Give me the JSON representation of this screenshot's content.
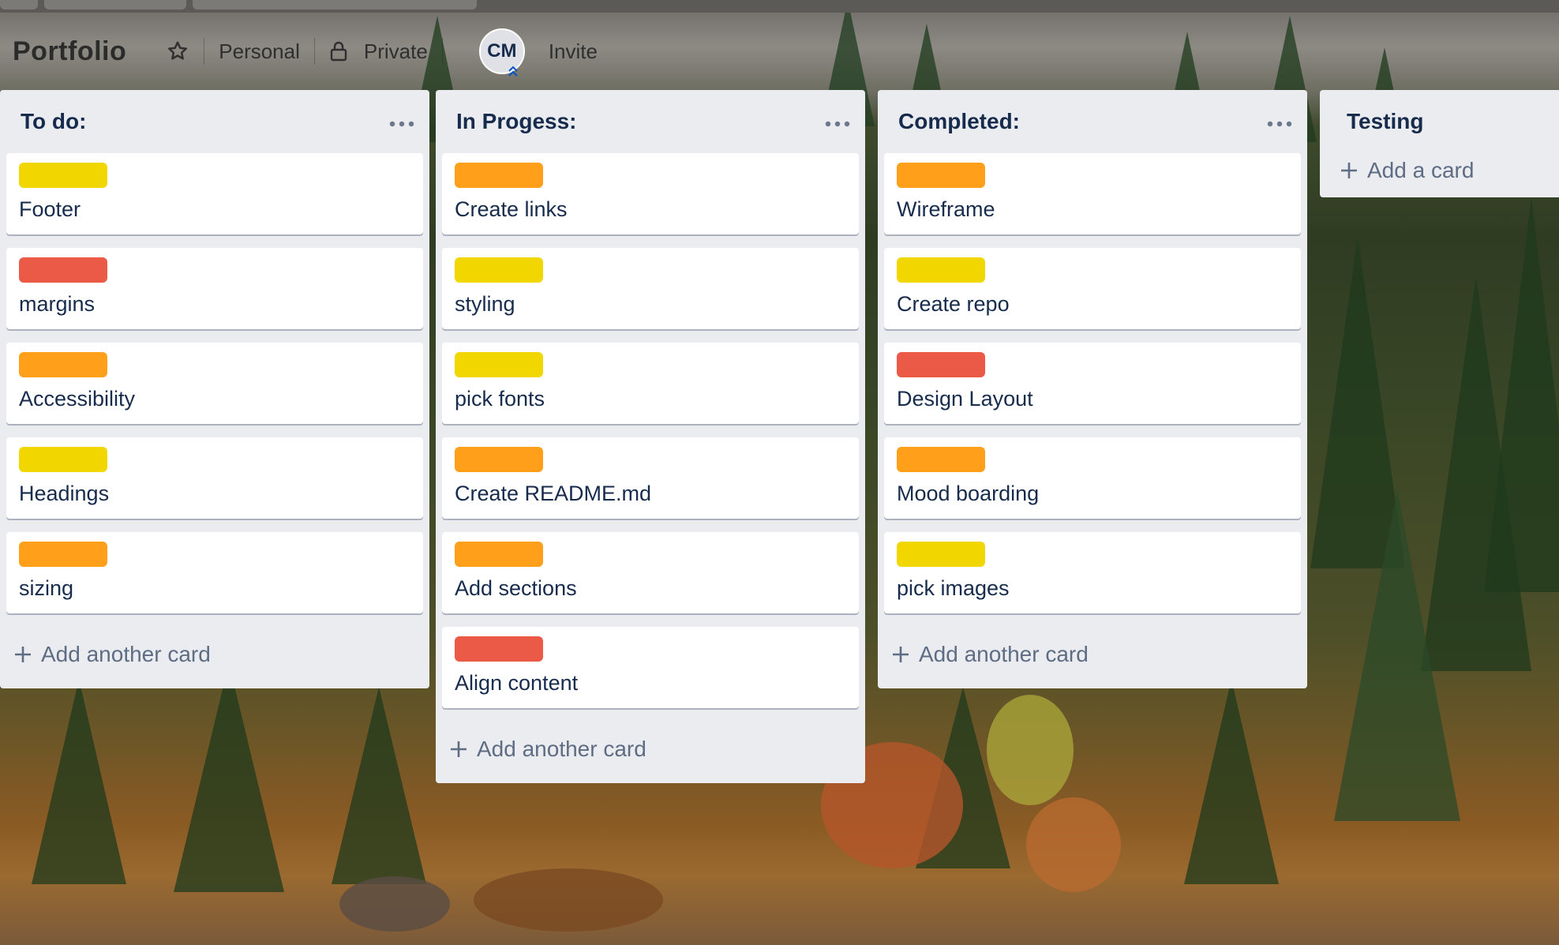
{
  "board": {
    "title": "Portfolio",
    "visibility_workspace": "Personal",
    "visibility_privacy": "Private",
    "member_initials": "CM",
    "invite_label": "Invite"
  },
  "colors": {
    "yellow": "#f2d600",
    "orange": "#ff9f1a",
    "red": "#eb5a46"
  },
  "lists": [
    {
      "title": "To do:",
      "cards": [
        {
          "label": "yellow",
          "text": "Footer"
        },
        {
          "label": "red",
          "text": "margins"
        },
        {
          "label": "orange",
          "text": "Accessibility"
        },
        {
          "label": "yellow",
          "text": "Headings"
        },
        {
          "label": "orange",
          "text": "sizing"
        }
      ],
      "add_label": "Add another card"
    },
    {
      "title": "In Progess:",
      "cards": [
        {
          "label": "orange",
          "text": "Create links"
        },
        {
          "label": "yellow",
          "text": "styling"
        },
        {
          "label": "yellow",
          "text": "pick fonts"
        },
        {
          "label": "orange",
          "text": "Create README.md"
        },
        {
          "label": "orange",
          "text": "Add sections"
        },
        {
          "label": "red",
          "text": "Align content"
        }
      ],
      "add_label": "Add another card"
    },
    {
      "title": "Completed:",
      "cards": [
        {
          "label": "orange",
          "text": "Wireframe"
        },
        {
          "label": "yellow",
          "text": "Create repo"
        },
        {
          "label": "red",
          "text": "Design Layout"
        },
        {
          "label": "orange",
          "text": "Mood boarding"
        },
        {
          "label": "yellow",
          "text": "pick images"
        }
      ],
      "add_label": "Add another card"
    },
    {
      "title": "Testing",
      "cards": [],
      "add_label": "Add a card"
    }
  ]
}
